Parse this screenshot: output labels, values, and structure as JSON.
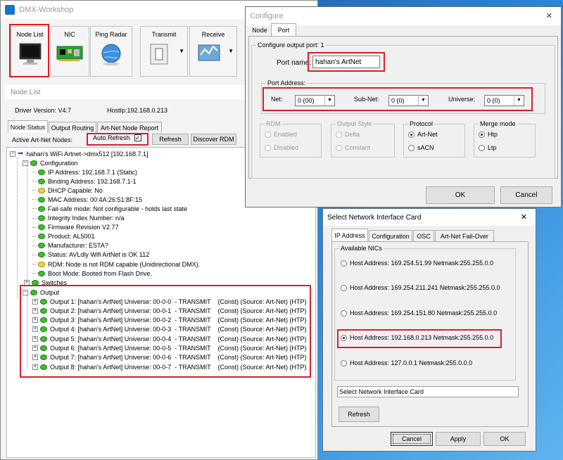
{
  "dmx": {
    "title": "DMX-Workshop",
    "toolbar": {
      "node_list": "Node List",
      "nic": "NIC",
      "ping_radar": "Ping Radar",
      "transmit": "Transmit",
      "receive": "Receive"
    },
    "panel_title": "Node List",
    "driver_version": "Driver Version: V4.7",
    "host_ip": "HostIp:192.168.0.213",
    "tabs": [
      "Node Status",
      "Output Routing",
      "Art-Net Node Report"
    ],
    "active_nodes_label": "Active Art-Net Nodes:",
    "auto_refresh": "Auto Refresh",
    "auto_refresh_checked": true,
    "refresh": "Refresh",
    "discover_rdm": "Discover RDM",
    "tree": {
      "root": "hahan's WiFi Artnet->dmx512 [192.168.7.1]",
      "configuration": "Configuration",
      "config_items": [
        {
          "text": "IP Address: 192.168.7.1 (Static)",
          "icon": "green"
        },
        {
          "text": "Binding Address: 192.168.7.1-1",
          "icon": "green"
        },
        {
          "text": "DHCP Capable: No",
          "icon": "yellow"
        },
        {
          "text": "MAC Address: 00:4A:26:51:8F:15",
          "icon": "green"
        },
        {
          "text": "Fail-safe mode: Not configurable - holds last state",
          "icon": "green"
        },
        {
          "text": "Integrity Index Number: n/a",
          "icon": "green"
        },
        {
          "text": "Firmware Revision V2.77",
          "icon": "green"
        },
        {
          "text": "Product: AL5001",
          "icon": "green"
        },
        {
          "text": "Manufacturer: ESTA?",
          "icon": "green"
        },
        {
          "text": "Status: AVLdly Wifi ArtNet is OK 112",
          "icon": "green"
        },
        {
          "text": "RDM: Node is not RDM capable (Unidirectional DMX).",
          "icon": "yellow"
        },
        {
          "text": "Boot Mode: Booted from Flash Drive.",
          "icon": "green"
        },
        {
          "text": "Switches",
          "icon": "green"
        }
      ],
      "output": "Output",
      "outputs": [
        "Output 1: [hahan's ArtNet] Universe: 00-0-0  - TRANSMIT    (Const) (Source: Art-Net) (HTP)",
        "Output 2: [hahan's ArtNet] Universe: 00-0-1  - TRANSMIT    (Const) (Source: Art-Net) (HTP)",
        "Output 3: [hahan's ArtNet] Universe: 00-0-2  - TRANSMIT    (Const) (Source: Art-Net) (HTP)",
        "Output 4: [hahan's ArtNet] Universe: 00-0-3  - TRANSMIT    (Const) (Source: Art-Net) (HTP)",
        "Output 5: [hahan's ArtNet] Universe: 00-0-4  - TRANSMIT    (Const) (Source: Art-Net) (HTP)",
        "Output 6: [hahan's ArtNet] Universe: 00-0-5  - TRANSMIT    (Const) (Source: Art-Net) (HTP)",
        "Output 7: [hahan's ArtNet] Universe: 00-0-6  - TRANSMIT    (Const) (Source: Art-Net) (HTP)",
        "Output 8: [hahan's ArtNet] Universe: 00-0-7  - TRANSMIT    (Const) (Source: Art-Net) (HTP)"
      ]
    }
  },
  "configure": {
    "title": "Configure",
    "close": "✕",
    "tabs": [
      "Node",
      "Port"
    ],
    "group_title": "Configure output port: 1",
    "port_name_label": "Port name:",
    "port_name_value": "hahan's ArtNet",
    "port_address_label": "Port Address:",
    "net_label": "Net:",
    "net_value": "0 (00)",
    "subnet_label": "Sub-Net:",
    "subnet_value": "0 (0)",
    "universe_label": "Universe:",
    "universe_value": "0 (0)",
    "rdm": {
      "title": "RDM",
      "options": [
        "Enabled",
        "Disabled"
      ]
    },
    "output_style": {
      "title": "Output Style",
      "options": [
        "Delta",
        "Constant"
      ]
    },
    "protocol": {
      "title": "Protocol",
      "options": [
        "Art-Net",
        "sACN"
      ],
      "selected": "Art-Net"
    },
    "merge_mode": {
      "title": "Merge mode",
      "options": [
        "Htp",
        "Ltp"
      ],
      "selected": "Htp"
    },
    "ok": "OK",
    "cancel": "Cancel"
  },
  "nic": {
    "title": "Select Network Interface Card",
    "close": "✕",
    "tabs": [
      "IP Address",
      "Configuration",
      "OSC",
      "Art-Net Fail-Over"
    ],
    "available_label": "Available NICs",
    "nics": [
      "Host Address: 169.254.51.99 Netmask:255.255.0.0",
      "Host Address: 169.254.211.241 Netmask:255.255.0.0",
      "Host Address: 169.254.151.80 Netmask:255.255.0.0",
      "Host Address: 192.168.0.213 Netmask:255.255.0.0",
      "Host Address: 127.0.0.1 Netmask:255.0.0.0"
    ],
    "selected_index": 3,
    "status_text": "Select Network Interface Card",
    "refresh": "Refresh",
    "cancel": "Cancel",
    "apply": "Apply",
    "ok": "OK"
  }
}
